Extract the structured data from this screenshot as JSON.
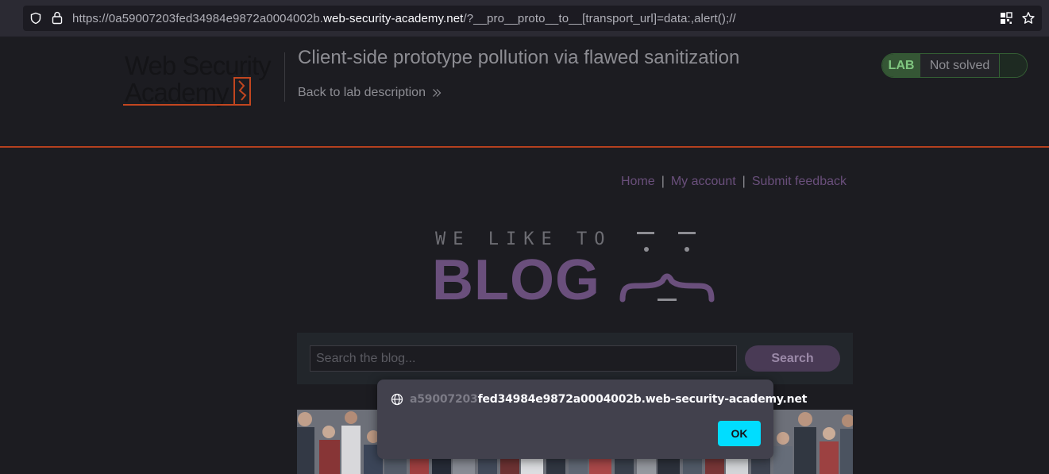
{
  "browser": {
    "url_prefix": "https://0a59007203fed34984e9872a0004002b.",
    "url_domain": "web-security-academy.net",
    "url_suffix": "/?__pro__proto__to__[transport_url]=data:,alert();//"
  },
  "lab": {
    "logo_lines": [
      "Web Security",
      "Academy"
    ],
    "title": "Client-side prototype pollution via flawed sanitization",
    "back_link": "Back to lab description",
    "badge_tag": "LAB",
    "badge_status": "Not solved"
  },
  "nav": {
    "items": [
      "Home",
      "My account",
      "Submit feedback"
    ],
    "separator": "|"
  },
  "blog_logo": {
    "tagline": "WE LIKE TO",
    "word": "BLOG"
  },
  "search": {
    "placeholder": "Search the blog...",
    "button_label": "Search"
  },
  "alert": {
    "origin_faded": "a59007203",
    "origin_rest": "fed34984e9872a0004002b.web-security-academy.net",
    "ok_label": "OK"
  },
  "colors": {
    "accent_orange": "#b5411f",
    "link_purple": "#6a4f7c",
    "ok_cyan": "#00ddff",
    "lab_green": "#355635"
  }
}
